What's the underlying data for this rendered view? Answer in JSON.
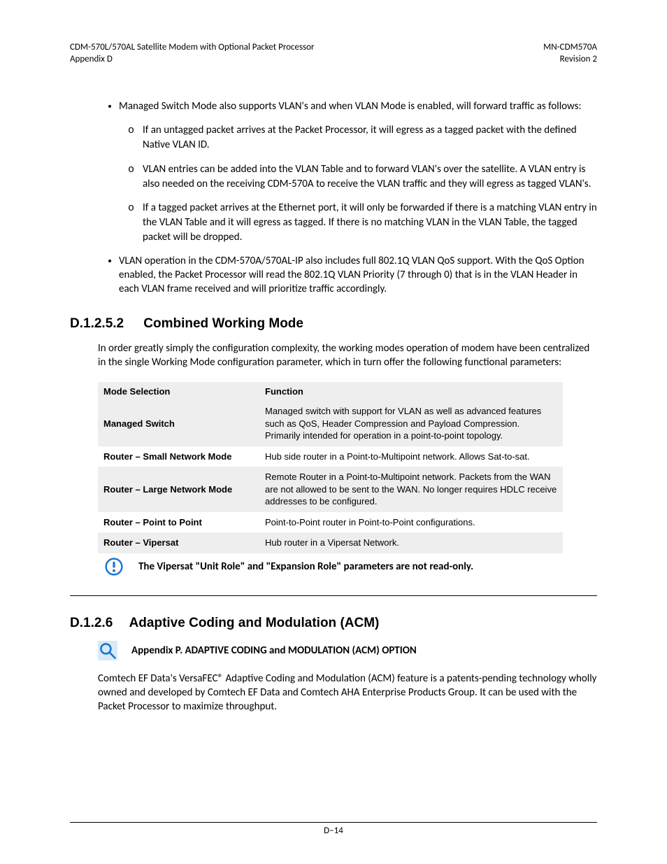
{
  "header": {
    "left_line1": "CDM-570L/570AL Satellite Modem with Optional Packet Processor",
    "left_line2": "Appendix D",
    "right_line1": "MN-CDM570A",
    "right_line2": "Revision 2"
  },
  "bullets_top": {
    "item1": "Managed Switch Mode also supports VLAN's and when VLAN Mode is enabled, will forward traffic as follows:",
    "sub1": "If an untagged packet arrives at the Packet Processor, it will egress as a tagged packet with the defined Native VLAN ID.",
    "sub2": "VLAN entries can be added into the VLAN Table and to forward VLAN's over the satellite. A VLAN entry is also needed on the receiving CDM-570A to receive the VLAN traffic and they will egress as tagged VLAN's.",
    "sub3": "If a tagged packet arrives at the Ethernet port, it will only be forwarded if there is a matching VLAN entry in the VLAN Table and it will egress as tagged. If there is no matching VLAN in the VLAN Table, the tagged packet will be dropped.",
    "item2": "VLAN operation in the CDM-570A/570AL-IP also includes full 802.1Q VLAN QoS support. With the QoS Option enabled, the Packet Processor will read the 802.1Q VLAN Priority (7 through 0) that is in the VLAN Header in each VLAN frame received and will prioritize traffic accordingly."
  },
  "sec1": {
    "num": "D.1.2.5.2",
    "title": "Combined Working Mode",
    "intro": "In order greatly simply the configuration complexity, the working modes operation of modem have been centralized in the single Working Mode configuration parameter, which in turn offer the following functional parameters:"
  },
  "table": {
    "h1": "Mode Selection",
    "h2": "Function",
    "rows": [
      {
        "label": "Managed Switch",
        "func": "Managed switch with support for VLAN as well as advanced features such as QoS, Header Compression and Payload Compression. Primarily intended for operation in a point-to-point topology."
      },
      {
        "label": "Router – Small Network Mode",
        "func": "Hub side router in a Point-to-Multipoint network. Allows Sat-to-sat."
      },
      {
        "label": "Router – Large Network Mode",
        "func": "Remote Router in a Point-to-Multipoint network. Packets from the WAN are not allowed to be sent to the WAN. No longer requires HDLC receive addresses to be configured."
      },
      {
        "label": "Router – Point to Point",
        "func": "Point-to-Point router in Point-to-Point configurations."
      },
      {
        "label": "Router – Vipersat",
        "func": "Hub router in a Vipersat Network."
      }
    ]
  },
  "note": "The Vipersat \"Unit Role\" and \"Expansion Role\" parameters are not read-only.",
  "sec2": {
    "num": "D.1.2.6",
    "title": "Adaptive Coding and Modulation (ACM)",
    "callout": "Appendix P. ADAPTIVE CODING and MODULATION (ACM) OPTION",
    "para": "Comtech EF Data's VersaFEC® Adaptive Coding and Modulation (ACM) feature is a patents-pending technology wholly owned and developed by Comtech EF Data and Comtech AHA Enterprise Products Group.  It can be used with the Packet Processor to maximize throughput."
  },
  "footer": "D–14"
}
